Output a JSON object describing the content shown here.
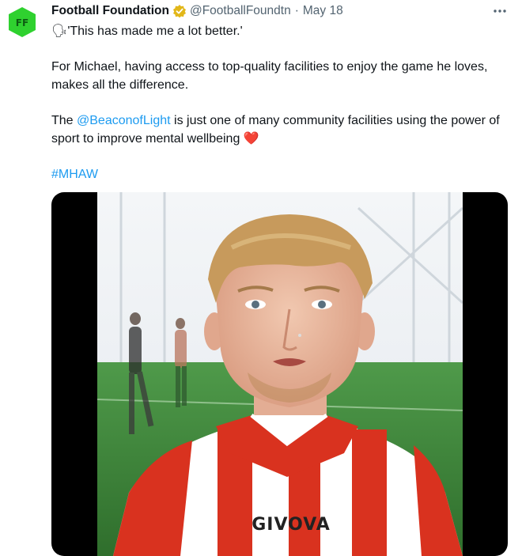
{
  "tweet": {
    "author_name": "Football Foundation",
    "handle": "@FootballFoundtn",
    "separator": "·",
    "date": "May 18",
    "avatar_text": "FF",
    "lines": {
      "quote_emoji": "🗣",
      "quote": "'This has made me a lot better.'",
      "para2": "For Michael, having access to top-quality facilities to enjoy the game he loves, makes all the difference.",
      "para3_prefix": "The ",
      "mention": "@BeaconofLight",
      "para3_suffix": " is just one of many community facilities using the power of sport to improve mental wellbeing",
      "heart": "❤️",
      "hashtag": "#MHAW"
    },
    "media": {
      "shirt_logo": "GIVOVA"
    }
  },
  "colors": {
    "link": "#1d9bf0",
    "muted": "#536471",
    "brand_green": "#2fd12f",
    "verified_gold": "#e2b719"
  },
  "icons": {
    "verified": "verified-badge-icon",
    "more": "more-options-icon"
  }
}
